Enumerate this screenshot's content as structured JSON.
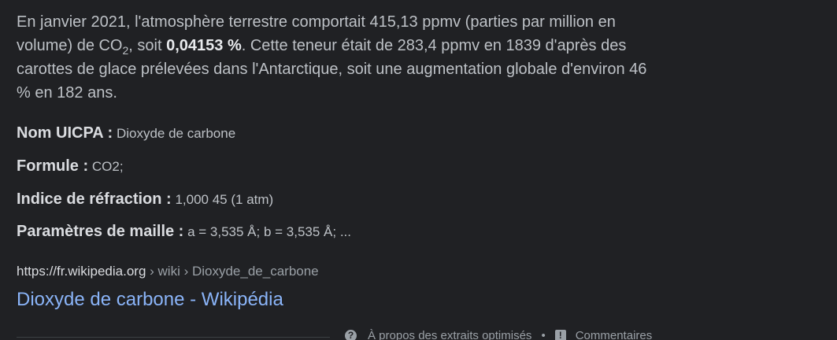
{
  "snippet": {
    "part1": "En janvier 2021, l'atmosphère terrestre comportait 415,13 ppmv (parties par million en volume) de CO",
    "sub": "2",
    "part2": ", soit ",
    "bold": "0,04153 %",
    "part3": ". Cette teneur était de 283,4 ppmv en 1839 d'après des carottes de glace prélevées dans l'Antarctique, soit une augmentation globale d'environ 46 % en 182 ans."
  },
  "attributes": [
    {
      "key": "Nom UICPA :",
      "value": "Dioxyde de carbone"
    },
    {
      "key": "Formule :",
      "value": "CO2;"
    },
    {
      "key": "Indice de réfraction :",
      "value": "1,000 45 (1 atm)"
    },
    {
      "key": "Paramètres de maille :",
      "value": "a = 3,535 Å; b = 3,535 Å; ..."
    }
  ],
  "citation": {
    "domain": "https://fr.wikipedia.org",
    "path": " › wiki › Dioxyde_de_carbone"
  },
  "result_title": "Dioxyde de carbone - Wikipédia",
  "footer": {
    "about_label": "À propos des extraits optimisés",
    "separator": "•",
    "feedback_label": "Commentaires"
  }
}
